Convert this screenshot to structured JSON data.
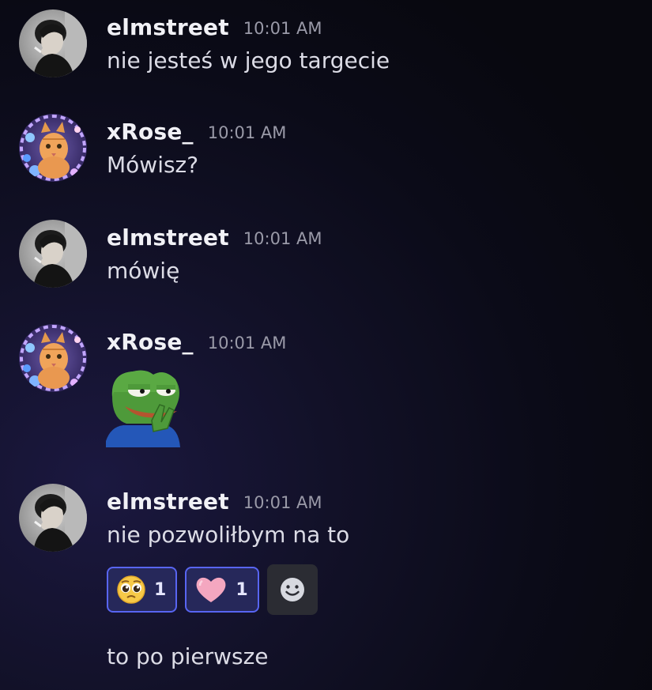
{
  "users": {
    "elm": {
      "name": "elmstreet",
      "avatar_icon": "user-photo-avatar"
    },
    "rose": {
      "name": "xRose_",
      "avatar_icon": "cat-avatar"
    }
  },
  "messages": [
    {
      "user": "elmstreet",
      "time": "10:01 AM",
      "text": "nie jesteś w jego targecie"
    },
    {
      "user": "xRose_",
      "time": "10:01 AM",
      "text": "Mówisz?"
    },
    {
      "user": "elmstreet",
      "time": "10:01 AM",
      "text": "mówię"
    },
    {
      "user": "xRose_",
      "time": "10:01 AM",
      "sticker": "pepe-hands-sticker"
    },
    {
      "user": "elmstreet",
      "time": "10:01 AM",
      "text": "nie pozwoliłbym na to",
      "reactions": [
        {
          "emoji": "pleading-face",
          "count": "1"
        },
        {
          "emoji": "pink-heart",
          "count": "1"
        }
      ],
      "add_reaction_icon": "smiley-add-reaction-icon",
      "followup_text": "to po pierwsze"
    }
  ],
  "colors": {
    "reaction_border": "#5865f2",
    "reaction_bg": "#26285a",
    "timestamp": "#9a9aa8"
  }
}
